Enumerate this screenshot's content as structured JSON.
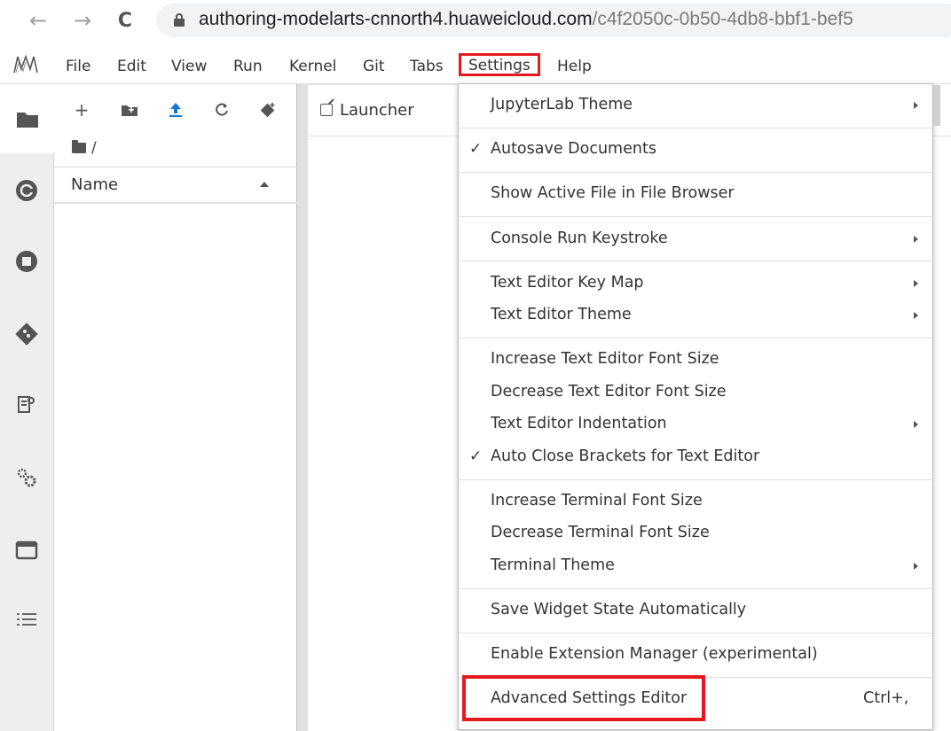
{
  "browser": {
    "url_host": "authoring-modelarts-cnnorth4.huaweicloud.com",
    "url_path": "/c4f2050c-0b50-4db8-bbf1-bef5",
    "back_icon": "arrow-left-icon",
    "forward_icon": "arrow-right-icon",
    "reload_icon": "reload-icon",
    "lock_icon": "lock-icon"
  },
  "menubar": {
    "items": [
      "File",
      "Edit",
      "View",
      "Run",
      "Kernel",
      "Git",
      "Tabs",
      "Settings",
      "Help"
    ],
    "active": "Settings",
    "highlight_color": "#e5191d"
  },
  "activity_bar": {
    "icons": [
      "folder-icon",
      "running-kernels-icon",
      "stop-icon",
      "git-icon",
      "property-inspector-icon",
      "extensions-icon",
      "tabs-icon",
      "table-of-contents-icon"
    ]
  },
  "file_browser": {
    "toolbar": [
      "new-launcher-icon",
      "new-folder-icon",
      "upload-icon",
      "refresh-icon",
      "git-clone-icon"
    ],
    "breadcrumb": "/",
    "column_name": "Name"
  },
  "dock": {
    "tab_label": "Launcher"
  },
  "settings_menu": {
    "items": [
      {
        "label": "JupyterLab Theme",
        "submenu": true,
        "checked": false
      },
      {
        "label": "Autosave Documents",
        "submenu": false,
        "checked": true
      },
      {
        "label": "Show Active File in File Browser",
        "submenu": false,
        "checked": false
      },
      {
        "label": "Console Run Keystroke",
        "submenu": true,
        "checked": false
      },
      {
        "label": "Text Editor Key Map",
        "submenu": true,
        "checked": false
      },
      {
        "label": "Text Editor Theme",
        "submenu": true,
        "checked": false
      },
      {
        "label": "Increase Text Editor Font Size",
        "submenu": false,
        "checked": false
      },
      {
        "label": "Decrease Text Editor Font Size",
        "submenu": false,
        "checked": false
      },
      {
        "label": "Text Editor Indentation",
        "submenu": true,
        "checked": false
      },
      {
        "label": "Auto Close Brackets for Text Editor",
        "submenu": false,
        "checked": true
      },
      {
        "label": "Increase Terminal Font Size",
        "submenu": false,
        "checked": false
      },
      {
        "label": "Decrease Terminal Font Size",
        "submenu": false,
        "checked": false
      },
      {
        "label": "Terminal Theme",
        "submenu": true,
        "checked": false
      },
      {
        "label": "Save Widget State Automatically",
        "submenu": false,
        "checked": false
      },
      {
        "label": "Enable Extension Manager (experimental)",
        "submenu": false,
        "checked": false
      },
      {
        "label": "Advanced Settings Editor",
        "submenu": false,
        "checked": false,
        "shortcut": "Ctrl+,",
        "highlighted": true
      }
    ],
    "check_glyph": "✓"
  }
}
